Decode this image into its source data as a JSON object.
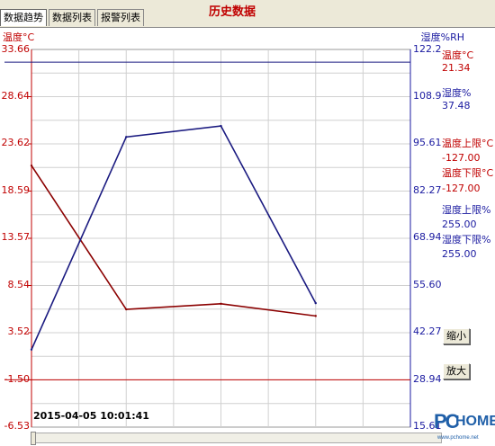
{
  "tabs": [
    {
      "label": "数据趋势",
      "active": true
    },
    {
      "label": "数据列表",
      "active": false
    },
    {
      "label": "报警列表",
      "active": false
    }
  ],
  "title": "历史数据",
  "left_axis": {
    "title": "温度°C",
    "ticks": [
      "33.66",
      "28.64",
      "23.62",
      "18.59",
      "13.57",
      "8.54",
      "3.52",
      "-1.50",
      "-6.53"
    ]
  },
  "right_axis": {
    "title": "湿度%RH",
    "ticks": [
      "122.2",
      "108.9",
      "95.61",
      "82.27",
      "68.94",
      "55.60",
      "42.27",
      "28.94",
      "15.61"
    ]
  },
  "legend": [
    {
      "name": "温度°C",
      "value": "21.34",
      "color": "#c00000"
    },
    {
      "name": "湿度%",
      "value": "37.48",
      "color": "#1a1aa0"
    },
    {
      "name": "温度上限°C",
      "value": "-127.00",
      "color": "#c00000"
    },
    {
      "name": "温度下限°C",
      "value": "-127.00",
      "color": "#c00000"
    },
    {
      "name": "湿度上限%",
      "value": "255.00",
      "color": "#1a1aa0"
    },
    {
      "name": "湿度下限%",
      "value": "255.00",
      "color": "#1a1aa0"
    }
  ],
  "buttons": {
    "zoom_out": "缩小",
    "zoom_in": "放大"
  },
  "timestamp": "2015-04-05 10:01:41",
  "watermark": {
    "brand_p": "PC",
    "brand_h": "HOME",
    "url": "www.pchome.net"
  },
  "chart_data": {
    "type": "line",
    "x": [
      0,
      1,
      2,
      3,
      4,
      5,
      6,
      7,
      8
    ],
    "series": [
      {
        "name": "温度°C",
        "axis": "left",
        "color": "#8b0000",
        "points": [
          [
            0,
            21.3
          ],
          [
            2,
            6.0
          ],
          [
            4,
            6.6
          ],
          [
            6,
            5.3
          ]
        ]
      },
      {
        "name": "湿度%",
        "axis": "right",
        "color": "#1a1a80",
        "points": [
          [
            0,
            37.5
          ],
          [
            2,
            97.5
          ],
          [
            4,
            100.6
          ],
          [
            6,
            50.6
          ]
        ]
      }
    ],
    "left_range": [
      -6.53,
      33.66
    ],
    "right_range": [
      15.61,
      122.2
    ],
    "x_range": [
      0,
      8
    ],
    "reference_lines": [
      {
        "axis": "right",
        "value": 118.6,
        "color": "#1a1a80"
      },
      {
        "axis": "left",
        "value": -1.5,
        "color": "#c00000"
      }
    ],
    "grid": true
  }
}
